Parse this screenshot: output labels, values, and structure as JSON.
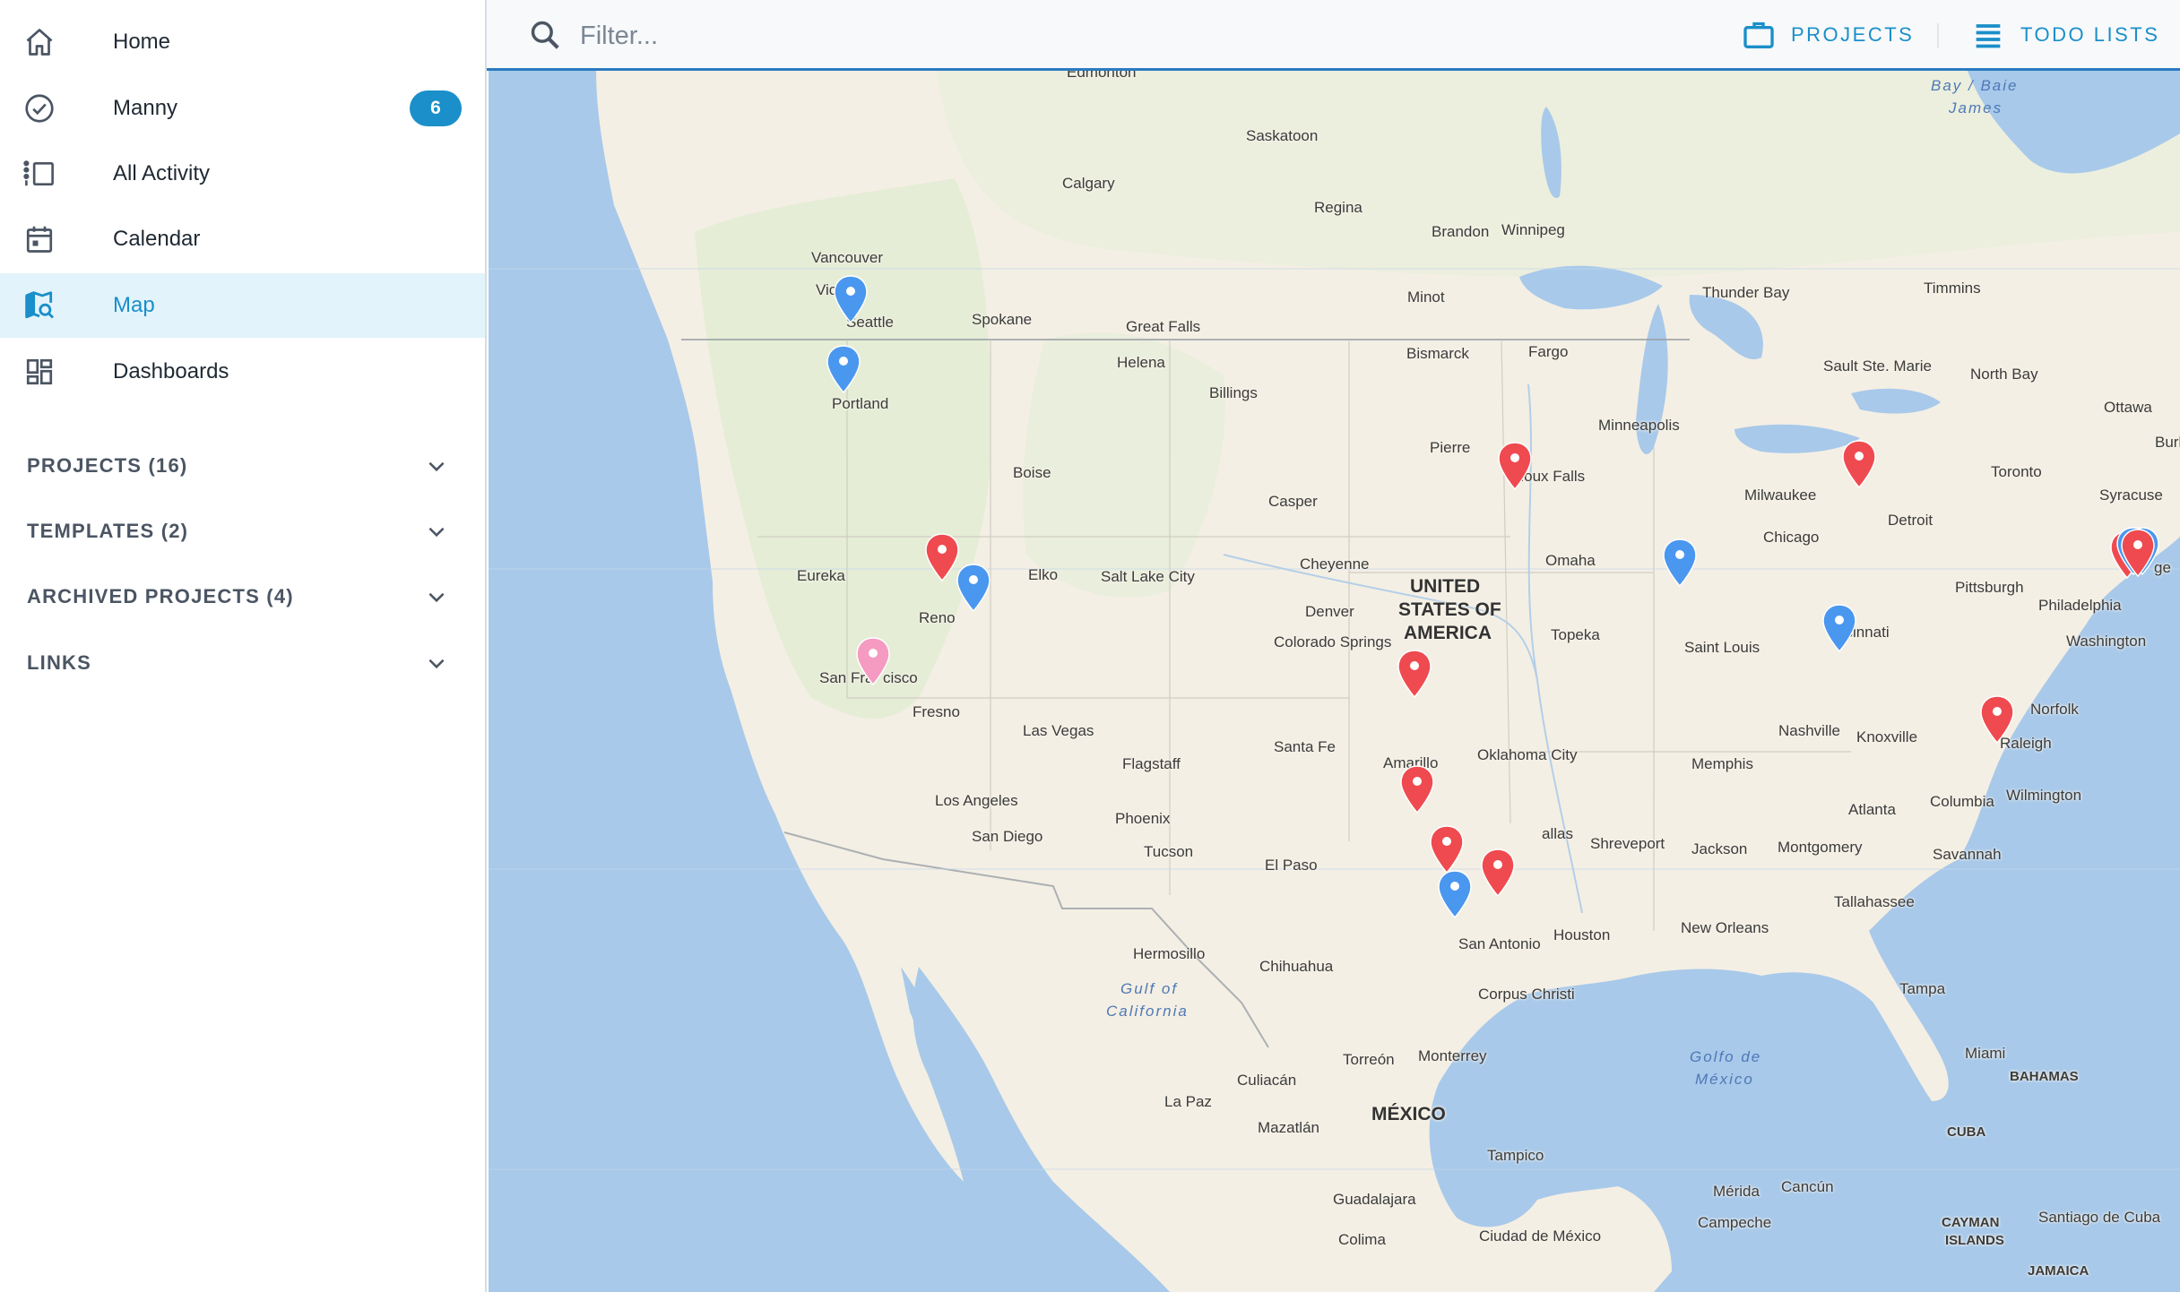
{
  "sidebar": {
    "nav": [
      {
        "id": "home",
        "label": "Home",
        "icon": "home-icon"
      },
      {
        "id": "manny",
        "label": "Manny",
        "icon": "check-circle-icon",
        "badge": "6"
      },
      {
        "id": "all-activity",
        "label": "All Activity",
        "icon": "activity-icon"
      },
      {
        "id": "calendar",
        "label": "Calendar",
        "icon": "calendar-icon"
      },
      {
        "id": "map",
        "label": "Map",
        "icon": "map-search-icon",
        "active": true
      },
      {
        "id": "dashboards",
        "label": "Dashboards",
        "icon": "dashboard-icon"
      }
    ],
    "sections": [
      {
        "label": "PROJECTS (16)"
      },
      {
        "label": "TEMPLATES (2)"
      },
      {
        "label": "ARCHIVED PROJECTS (4)"
      },
      {
        "label": "LINKS"
      }
    ]
  },
  "topbar": {
    "filter_placeholder": "Filter...",
    "projects_label": "PROJECTS",
    "todo_label": "TODO LISTS"
  },
  "colors": {
    "accent": "#1a8fc9",
    "active_bg": "#e3f3fb",
    "pin_red": "#ef4a4f",
    "pin_blue": "#4a97ef",
    "pin_pink": "#f59ac0",
    "water": "#a8c9ea",
    "land": "#f4efe4"
  },
  "map": {
    "labels": {
      "edmonton": "Edmonton",
      "saskatoon": "Saskatoon",
      "calgary": "Calgary",
      "regina": "Regina",
      "brandon": "Brandon",
      "winnipeg": "Winnipeg",
      "vancouver": "Vancouver",
      "victoria": "Victo",
      "seattle": "Seattle",
      "spokane": "Spokane",
      "portland": "Portland",
      "great_falls": "Great Falls",
      "helena": "Helena",
      "billings": "Billings",
      "minot": "Minot",
      "bismarck": "Bismarck",
      "fargo": "Fargo",
      "thunder_bay": "Thunder Bay",
      "timmins": "Timmins",
      "sault": "Sault Ste. Marie",
      "north_bay": "North Bay",
      "ottawa": "Ottawa",
      "burlington": "Burlin",
      "boise": "Boise",
      "casper": "Casper",
      "pierre": "Pierre",
      "sioux_falls": "Sioux Falls",
      "minneapolis": "Minneapolis",
      "milwaukee": "Milwaukee",
      "toronto": "Toronto",
      "syracuse": "Syracuse",
      "detroit": "Detroit",
      "chicago": "Chicago",
      "eureka": "Eureka",
      "elko": "Elko",
      "salt_lake": "Salt Lake City",
      "cheyenne": "Cheyenne",
      "omaha": "Omaha",
      "pittsburgh": "Pittsburgh",
      "philadelphia": "Philadelphia",
      "washington": "Washington",
      "reno": "Reno",
      "denver": "Denver",
      "colorado_springs": "Colorado Springs",
      "topeka": "Topeka",
      "saint_louis": "Saint Louis",
      "cincinnati": "ncinnati",
      "san_francisco_a": "San Fra",
      "san_francisco_b": "cisco",
      "fresno": "Fresno",
      "las_vegas": "Las Vegas",
      "norfolk": "Norfolk",
      "nashville": "Nashville",
      "knoxville": "Knoxville",
      "raleigh": "Raleigh",
      "santa_fe": "Santa Fe",
      "amarillo": "Amarillo",
      "oklahoma_city": "Oklahoma City",
      "memphis": "Memphis",
      "flagstaff": "Flagstaff",
      "los_angeles": "Los Angeles",
      "wilmington": "Wilmington",
      "atlanta": "Atlanta",
      "columbia": "Columbia",
      "phoenix": "Phoenix",
      "dallas": "allas",
      "shreveport": "Shreveport",
      "jackson": "Jackson",
      "montgomery": "Montgomery",
      "san_diego": "San Diego",
      "tucson": "Tucson",
      "el_paso": "El Paso",
      "savannah": "Savannah",
      "tallahassee": "Tallahassee",
      "new_orleans": "New Orleans",
      "houston": "Houston",
      "san_antonio": "San Antonio",
      "hermosillo": "Hermosillo",
      "chihuahua": "Chihuahua",
      "corpus_christi": "Corpus Christi",
      "tampa": "Tampa",
      "miami": "Miami",
      "bahamas": "BAHAMAS",
      "torreon": "Torreón",
      "monterrey": "Monterrey",
      "culiacan": "Culiacán",
      "la_paz": "La Paz",
      "mazatlan": "Mazatlán",
      "tampico": "Tampico",
      "cuba": "CUBA",
      "merida": "Mérida",
      "cancun": "Cancún",
      "guadalajara": "Guadalajara",
      "campeche": "Campeche",
      "cayman_a": "CAYMAN",
      "cayman_b": "ISLANDS",
      "santiago": "Santiago de Cuba",
      "colima": "Colima",
      "ciudad_mexico": "Ciudad de México",
      "jamaica": "JAMAICA",
      "usa_1": "UNITED",
      "usa_2": "STATES OF",
      "usa_3": "AMERICA",
      "mexico": "MÉXICO",
      "bay_james_1": "Bay / Baie",
      "bay_james_2": "James",
      "gulf_cal_1": "Gulf of",
      "gulf_cal_2": "California",
      "golfo_1": "Golfo de",
      "golfo_2": "México",
      "ge": "ge"
    }
  }
}
